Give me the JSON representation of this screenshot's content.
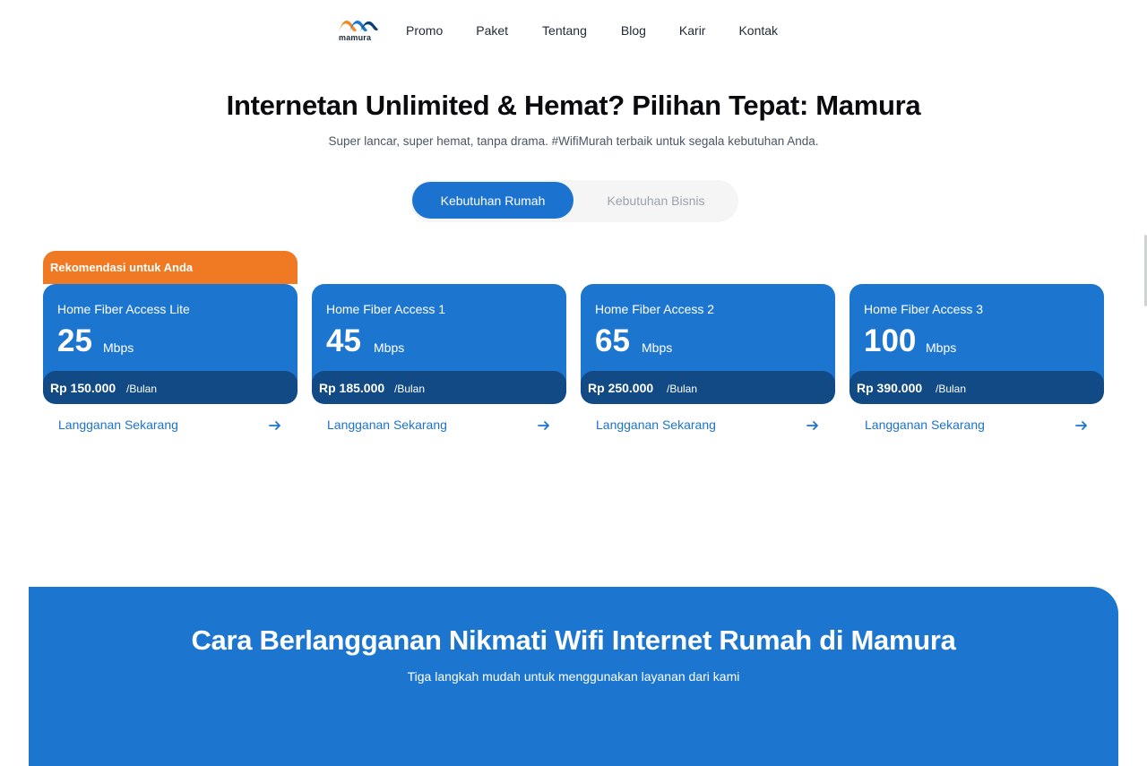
{
  "header": {
    "logo_text": "mamura",
    "nav": [
      "Promo",
      "Paket",
      "Tentang",
      "Blog",
      "Karir",
      "Kontak"
    ]
  },
  "hero": {
    "title": "Internetan Unlimited & Hemat? Pilihan Tepat: Mamura",
    "subtitle": "Super lancar, super hemat, tanpa drama. #WifiMurah terbaik untuk segala kebutuhan Anda."
  },
  "toggle": {
    "home_label": "Kebutuhan Rumah",
    "business_label": "Kebutuhan Bisnis",
    "active": "home"
  },
  "plans": [
    {
      "badge": "Rekomendasi untuk Anda",
      "name": "Home Fiber Access Lite",
      "speed": "25",
      "unit": "Mbps",
      "price": "Rp 150.000",
      "per": "/Bulan",
      "cta": "Langganan Sekarang"
    },
    {
      "badge": "",
      "name": "Home Fiber Access 1",
      "speed": "45",
      "unit": "Mbps",
      "price": "Rp 185.000",
      "per": "/Bulan",
      "cta": "Langganan Sekarang"
    },
    {
      "badge": "",
      "name": "Home Fiber Access 2",
      "speed": "65",
      "unit": "Mbps",
      "price": "Rp 250.000",
      "per": "/Bulan",
      "cta": "Langganan Sekarang"
    },
    {
      "badge": "",
      "name": "Home Fiber Access 3",
      "speed": "100",
      "unit": "Mbps",
      "price": "Rp 390.000",
      "per": "/Bulan",
      "cta": "Langganan Sekarang"
    }
  ],
  "steps": {
    "title": "Cara Berlangganan Nikmati Wifi Internet Rumah di Mamura",
    "subtitle": "Tiga langkah mudah untuk menggunakan layanan dari kami"
  },
  "colors": {
    "primary": "#1c76d0",
    "primary_dark": "#114a84",
    "accent": "#ef7a23"
  },
  "icons": {
    "logo": "mamura-logo-icon",
    "cta": "arrow-right-icon"
  }
}
